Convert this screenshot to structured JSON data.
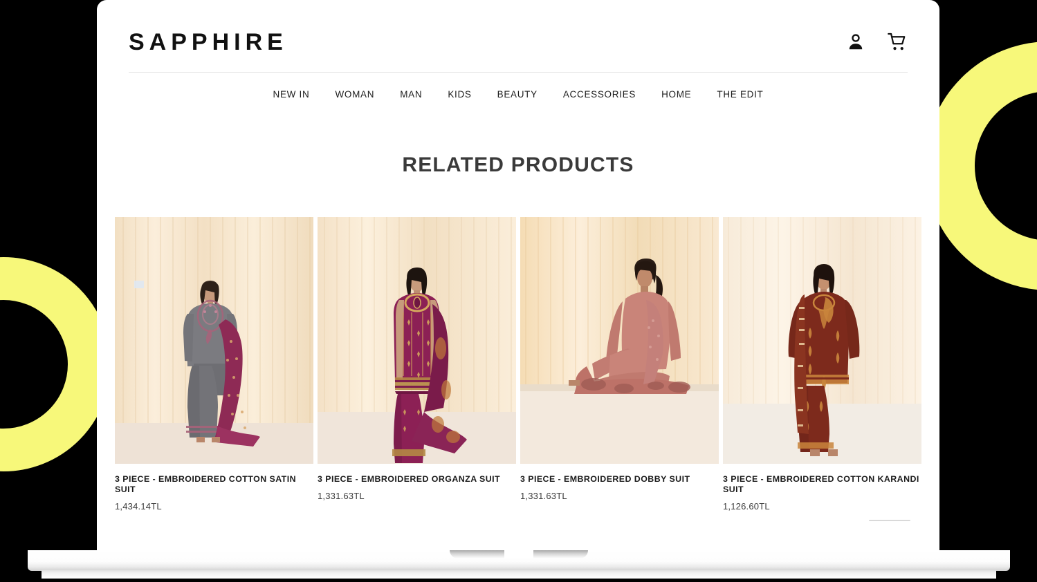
{
  "brand": {
    "logo": "SAPPHIRE"
  },
  "header": {
    "account_icon": "person-icon",
    "cart_icon": "shopping-cart-icon"
  },
  "nav": {
    "items": [
      {
        "label": "NEW IN"
      },
      {
        "label": "WOMAN"
      },
      {
        "label": "MAN"
      },
      {
        "label": "KIDS"
      },
      {
        "label": "BEAUTY"
      },
      {
        "label": "ACCESSORIES"
      },
      {
        "label": "HOME"
      },
      {
        "label": "THE EDIT"
      }
    ]
  },
  "section": {
    "title": "RELATED PRODUCTS"
  },
  "products": [
    {
      "title": "3 PIECE - EMBROIDERED COTTON SATIN SUIT",
      "price": "1,434.14TL",
      "garment_color": "#77777c",
      "accent_color": "#8e2a55",
      "backdrop_color": "#f6e2c8"
    },
    {
      "title": "3 PIECE - EMBROIDERED ORGANZA SUIT",
      "price": "1,331.63TL",
      "garment_color": "#8c2055",
      "accent_color": "#c79a4e",
      "backdrop_color": "#f7e6cf"
    },
    {
      "title": "3 PIECE - EMBROIDERED DOBBY SUIT",
      "price": "1,331.63TL",
      "garment_color": "#c98479",
      "accent_color": "#b06b62",
      "backdrop_color": "#f7dfbc"
    },
    {
      "title": "3 PIECE - EMBROIDERED COTTON KARANDI SUIT",
      "price": "1,126.60TL",
      "garment_color": "#7d2a1c",
      "accent_color": "#c9853c",
      "backdrop_color": "#f8ecdc"
    }
  ],
  "decor": {
    "background_color": "#000000",
    "ring_color": "#f7f87a",
    "device": "laptop-mockup"
  }
}
